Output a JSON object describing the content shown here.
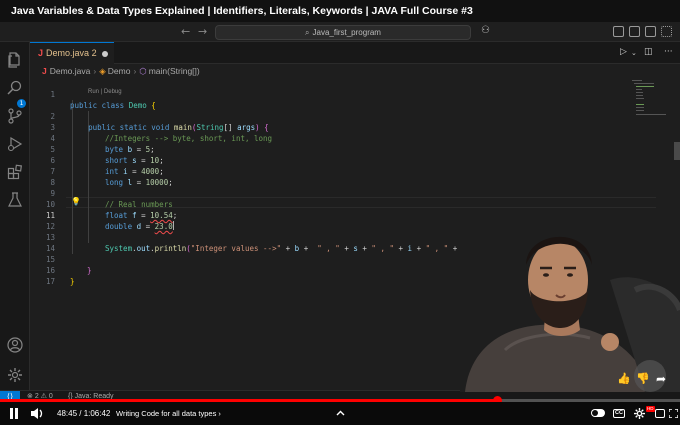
{
  "video": {
    "title": "Java Variables & Data Types Explained | Identifiers, Literals, Keywords | JAVA Full Course #3",
    "time_display": "48:45 / 1:06:42",
    "chapter": "Writing Code for all data types",
    "chapter_chevron": "›",
    "progress_fraction": 0.731,
    "settings_badge": "HD",
    "cc_label": "CC",
    "icons": [
      "pause-icon",
      "volume-icon",
      "chevron-up-icon",
      "autoplay-toggle",
      "subtitles-icon",
      "settings-icon",
      "miniplayer-icon",
      "fullscreen-icon",
      "like-icon",
      "dislike-icon",
      "share-icon"
    ]
  },
  "titlebar": {
    "search_text": "Java_first_program",
    "back_arrow": "←",
    "forward_arrow": "→"
  },
  "activity_bar": {
    "explorer_badge": "1",
    "icons": [
      "files-icon",
      "search-icon",
      "source-control-icon",
      "run-debug-icon",
      "extensions-icon",
      "testing-icon",
      "account-icon",
      "manage-gear-icon"
    ]
  },
  "tab": {
    "file_icon": "J",
    "label": "Demo.java",
    "problems": "2"
  },
  "breadcrumb": {
    "file_icon": "J",
    "file": "Demo.java",
    "class": "Demo",
    "method": "main(String[])"
  },
  "editor": {
    "codelens": "Run | Debug",
    "active_line": 11,
    "line_numbers": [
      "1",
      "2",
      "3",
      "4",
      "5",
      "6",
      "7",
      "8",
      "9",
      "10",
      "11",
      "12",
      "13",
      "14",
      "15",
      "16",
      "17"
    ],
    "lines": [
      "public class Demo {",
      "public static void main(String[] args) {",
      "//Integers --> byte, short, int, long",
      "byte b = 5;",
      "short s = 10;",
      "int i = 4000;",
      "long l = 10000;",
      "",
      "// Real numbers",
      "float f = 10.54;",
      "double d = 23.0",
      "",
      "System.out.println(\"Integer values -->\" + b +  \" , \" + s + \" , \" + i + \" , \" + l);",
      "",
      "}",
      "}",
      ""
    ]
  },
  "statusbar": {
    "errors": "2",
    "warnings": "0",
    "java_status": "Java: Ready"
  }
}
